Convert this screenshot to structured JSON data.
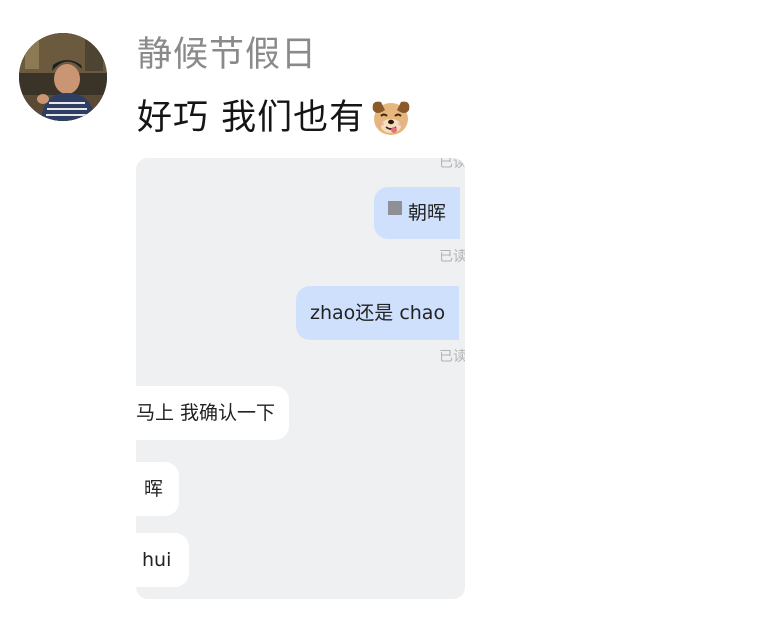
{
  "post": {
    "username": "静候节假日",
    "message": "好巧 我们也有",
    "emoji_icon": "dog-face-emoji"
  },
  "screenshot": {
    "read_label": "已读",
    "messages": [
      {
        "side": "outgoing",
        "text": "朝晖"
      },
      {
        "side": "outgoing",
        "text": "zhao还是 chao"
      },
      {
        "side": "incoming",
        "text": "马上 我确认一下"
      },
      {
        "side": "incoming",
        "text": "晖"
      },
      {
        "side": "incoming",
        "text": "hui"
      }
    ]
  },
  "colors": {
    "username": "#8a8a8a",
    "outgoing_bubble": "#cfe0fd",
    "incoming_bubble": "#ffffff",
    "chat_background": "#eef0f1"
  }
}
